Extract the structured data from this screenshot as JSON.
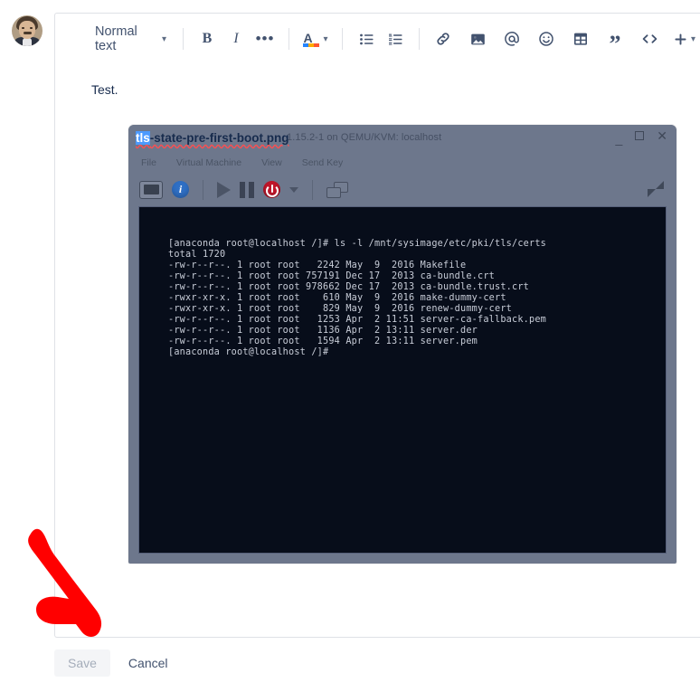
{
  "avatar": {
    "name": "user-avatar"
  },
  "toolbar": {
    "style_label": "Normal text",
    "style_chevron": "chevron-down-icon",
    "bold_label": "B",
    "italic_label": "I",
    "more_label": "•••",
    "text_color_letter": "A",
    "text_color_chevron": "chevron-down-icon",
    "text_color_swatches": [
      "#2684ff",
      "#ffab00",
      "#ff5630"
    ],
    "items": [
      {
        "name": "bullet-list",
        "label": "Bullet list"
      },
      {
        "name": "numbered-list",
        "label": "Numbered list"
      },
      {
        "name": "link",
        "label": "Link"
      },
      {
        "name": "image",
        "label": "Image"
      },
      {
        "name": "mention",
        "label": "Mention"
      },
      {
        "name": "emoji",
        "label": "Emoji"
      },
      {
        "name": "table",
        "label": "Table"
      },
      {
        "name": "quote",
        "label": "Quote"
      },
      {
        "name": "code",
        "label": "Code snippet"
      },
      {
        "name": "insert-more",
        "label": "Insert more"
      }
    ]
  },
  "document": {
    "body_text": "Test.",
    "attachment_filename": "tls-state-pre-first-boot.png",
    "filename_highlighted_part": "tls",
    "filename_rest": "-state-pre-first-boot.png"
  },
  "vm_window": {
    "title": "1.15.2-1 on QEMU/KVM: localhost",
    "window_buttons": [
      "minimize",
      "maximize",
      "close"
    ],
    "menus": [
      "File",
      "Virtual Machine",
      "View",
      "Send Key"
    ],
    "toolbar_icons": [
      "console-icon",
      "info-icon",
      "play-icon",
      "pause-icon",
      "power-icon",
      "power-dropdown-icon",
      "snapshot-icon",
      "fullscreen-icon"
    ],
    "terminal_lines": [
      "[anaconda root@localhost /]# ls -l /mnt/sysimage/etc/pki/tls/certs",
      "total 1720",
      "-rw-r--r--. 1 root root   2242 May  9  2016 Makefile",
      "-rw-r--r--. 1 root root 757191 Dec 17  2013 ca-bundle.crt",
      "-rw-r--r--. 1 root root 978662 Dec 17  2013 ca-bundle.trust.crt",
      "-rwxr-xr-x. 1 root root    610 May  9  2016 make-dummy-cert",
      "-rwxr-xr-x. 1 root root    829 May  9  2016 renew-dummy-cert",
      "-rw-r--r--. 1 root root   1253 Apr  2 11:51 server-ca-fallback.pem",
      "-rw-r--r--. 1 root root   1136 Apr  2 13:11 server.der",
      "-rw-r--r--. 1 root root   1594 Apr  2 13:11 server.pem",
      "[anaconda root@localhost /]#"
    ]
  },
  "footer": {
    "save_label": "Save",
    "cancel_label": "Cancel"
  },
  "annotation": {
    "arrow_color": "#ff0000",
    "arrow_name": "red-arrow-annotation"
  },
  "colors": {
    "toolbar_icon": "#42526e",
    "text": "#172b4d",
    "border": "#dfe1e6",
    "terminal_bg": "#070d1a",
    "terminal_text": "#c8cdd8",
    "vm_chrome": "#6d778c",
    "highlight": "#4c9aff"
  }
}
